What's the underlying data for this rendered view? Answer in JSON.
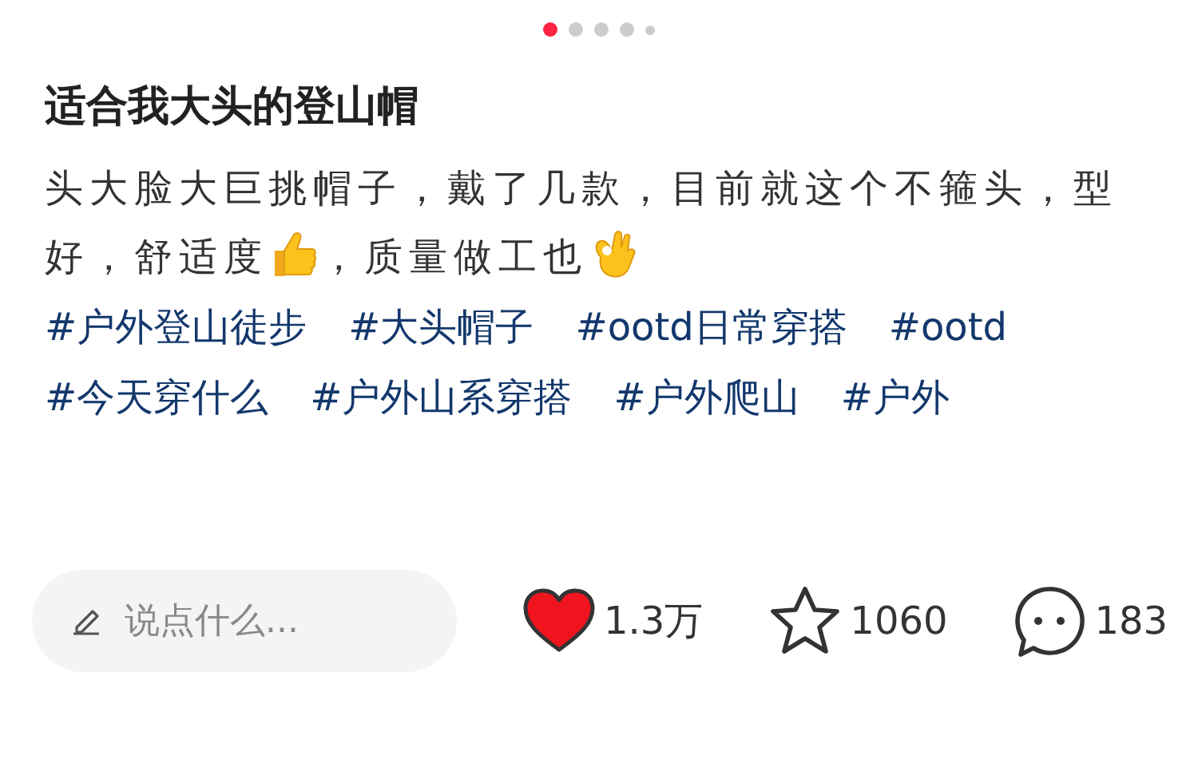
{
  "pager": [
    {
      "selected": true
    },
    {
      "selected": false
    },
    {
      "selected": false
    },
    {
      "selected": false
    },
    {
      "selected": false
    }
  ],
  "title": "适合我大头的登山帽",
  "body": [
    {
      "kind": "text",
      "text": "头大脸大巨挑帽子，戴了几款，目前就这个不箍头，型好，舒适度"
    },
    {
      "kind": "thumbs_up"
    },
    {
      "kind": "text",
      "text": "，质量做工也"
    },
    {
      "kind": "ok_hand"
    }
  ],
  "tags": [
    "#户外登山徒步",
    "#大头帽子",
    "#ootd日常穿搭",
    "#ootd",
    "#今天穿什么",
    "#户外山系穿搭",
    "#户外爬山",
    "#户外"
  ],
  "comment_field": {
    "placeholder": "说点什么..."
  },
  "actions": [
    {
      "kind": "like",
      "active": true,
      "count": "1.3万"
    },
    {
      "kind": "collect",
      "active": false,
      "count": "1060"
    },
    {
      "kind": "comment",
      "count": "183"
    }
  ]
}
